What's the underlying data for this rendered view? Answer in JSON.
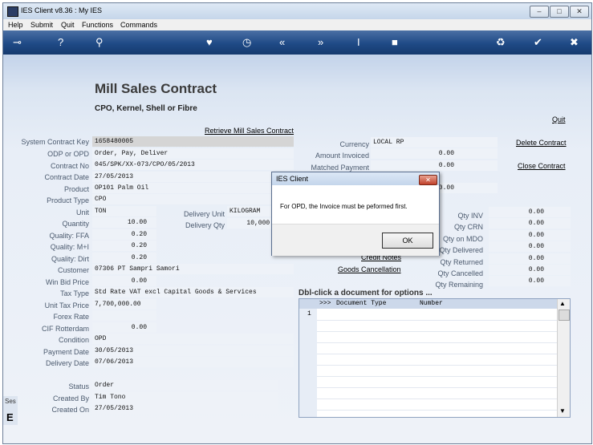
{
  "window": {
    "title": "IES Client v8.36 : My IES",
    "min": "–",
    "max": "□",
    "close": "✕"
  },
  "menu": [
    "Help",
    "Submit",
    "Quit",
    "Functions",
    "Commands"
  ],
  "toolbar": {
    "key": "⊸",
    "help": "?",
    "search": "⚲",
    "heart": "♥",
    "clock": "◷",
    "back": "«",
    "forward": "»",
    "cursor": "I",
    "square": "■",
    "recycle": "♻",
    "check": "✔",
    "close": "✖"
  },
  "page": {
    "title": "Mill Sales Contract",
    "subtitle": "CPO, Kernel, Shell or Fibre",
    "retrieve_link": "Retrieve Mill Sales Contract"
  },
  "actions": {
    "quit": "Quit",
    "delete": "Delete Contract",
    "close": "Close Contract"
  },
  "left_fields": [
    {
      "label": "System Contract Key",
      "value": "1658480005"
    },
    {
      "label": "ODP or OPD",
      "value": "Order, Pay, Deliver"
    },
    {
      "label": "Contract No",
      "value": "045/SPK/XX-073/CPO/05/2013"
    },
    {
      "label": "Contract Date",
      "value": "27/05/2013"
    },
    {
      "label": "Product",
      "value": "OP101 Palm Oil"
    },
    {
      "label": "Product Type",
      "value": "CPO"
    },
    {
      "label": "Unit",
      "value": "TON"
    },
    {
      "label": "Quantity",
      "value": "10.00"
    },
    {
      "label": "Quality: FFA",
      "value": "0.20"
    },
    {
      "label": "Quality: M+I",
      "value": "0.20"
    },
    {
      "label": "Quality: Dirt",
      "value": "0.20"
    },
    {
      "label": "Customer",
      "value": "07306 PT Sampri Samori"
    },
    {
      "label": "Win Bid Price",
      "value": "0.00"
    },
    {
      "label": "Tax Type",
      "value": "Std Rate VAT excl Capital Goods & Services"
    },
    {
      "label": "Unit Tax Price",
      "value": "7,700,000.00"
    },
    {
      "label": "Forex Rate",
      "value": ""
    },
    {
      "label": "CIF Rotterdam",
      "value": "0.00"
    },
    {
      "label": "Condition",
      "value": "OPD"
    },
    {
      "label": "Payment Date",
      "value": "30/05/2013"
    },
    {
      "label": "Delivery Date",
      "value": "07/06/2013"
    }
  ],
  "delivery": {
    "unit_label": "Delivery Unit",
    "unit_value": "KILOGRAM",
    "qty_label": "Delivery Qty",
    "qty_value": "10,000."
  },
  "status_fields": [
    {
      "label": "Status",
      "value": "Order"
    },
    {
      "label": "Created By",
      "value": "Tim Tono"
    },
    {
      "label": "Created On",
      "value": "27/05/2013"
    }
  ],
  "currency": {
    "currency_label": "Currency",
    "currency_value": "LOCAL RP",
    "invoiced_label": "Amount Invoiced",
    "invoiced_value": "0.00",
    "matched_label": "Matched Payment",
    "matched_value": "0.00",
    "r3_value": "0.00"
  },
  "qty": [
    {
      "label": "Qty INV",
      "value": "0.00"
    },
    {
      "label": "Qty CRN",
      "value": "0.00"
    },
    {
      "label": "Qty on MDO",
      "value": "0.00"
    },
    {
      "label": "Qty Delivered",
      "value": "0.00"
    },
    {
      "label": "Qty Returned",
      "value": "0.00"
    },
    {
      "label": "Qty Cancelled",
      "value": "0.00"
    },
    {
      "label": "Qty Remaining",
      "value": "0.00"
    }
  ],
  "doc_links": {
    "credit_notes": "Credit Notes",
    "goods_cancellation": "Goods Cancellation"
  },
  "doc_grid": {
    "heading": "Dbl-click a document for options ...",
    "col0": ">>>",
    "col1": "Document Type",
    "col2": "Number",
    "row1": "1",
    "scroll_up": "▲",
    "scroll_down": "▼"
  },
  "dialog": {
    "title": "IES Client",
    "message": "For OPD, the Invoice must be peformed first.",
    "ok": "OK",
    "close": "✕"
  },
  "edge": {
    "ses": "Ses",
    "e": "E"
  }
}
